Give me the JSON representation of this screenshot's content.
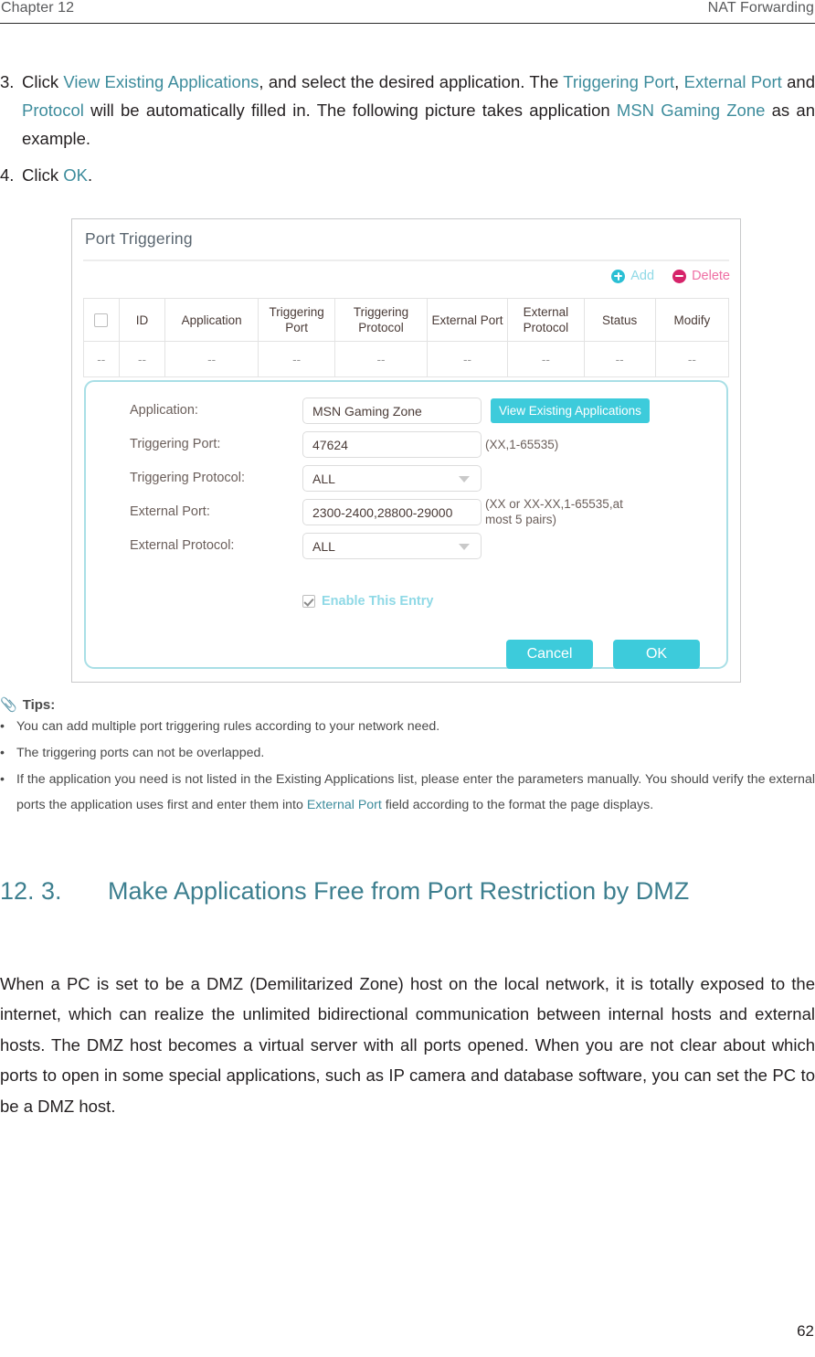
{
  "running_head": {
    "left": "Chapter 12",
    "right": "NAT Forwarding"
  },
  "steps": [
    {
      "number": "3.",
      "segments": [
        {
          "t": "Click ",
          "link": false
        },
        {
          "t": "View Existing Applications",
          "link": true
        },
        {
          "t": ", and select the desired application. The ",
          "link": false
        },
        {
          "t": "Triggering Port",
          "link": true
        },
        {
          "t": ", ",
          "link": false
        },
        {
          "t": "External Port",
          "link": true
        },
        {
          "t": " and ",
          "link": false
        },
        {
          "t": "Protocol",
          "link": true
        },
        {
          "t": " will be automatically filled in. The following picture takes application ",
          "link": false
        },
        {
          "t": "MSN Gaming Zone",
          "link": true
        },
        {
          "t": " as an example.",
          "link": false
        }
      ]
    },
    {
      "number": "4.",
      "segments": [
        {
          "t": "Click ",
          "link": false
        },
        {
          "t": "OK",
          "link": true
        },
        {
          "t": ".",
          "link": false
        }
      ]
    }
  ],
  "panel": {
    "title": "Port Triggering",
    "toolbar": {
      "add_label": "Add",
      "delete_label": "Delete",
      "add_icon": "plus-circle-icon",
      "delete_icon": "minus-circle-icon"
    },
    "table": {
      "headers": [
        "",
        "ID",
        "Application",
        "Triggering Port",
        "Triggering Protocol",
        "External Port",
        "External Protocol",
        "Status",
        "Modify"
      ],
      "rows": [
        [
          "--",
          "--",
          "--",
          "--",
          "--",
          "--",
          "--",
          "--",
          "--"
        ]
      ]
    },
    "form": {
      "fields": [
        {
          "label": "Application:",
          "type": "text",
          "value": "MSN Gaming Zone",
          "hint": "",
          "button": "View Existing Applications"
        },
        {
          "label": "Triggering Port:",
          "type": "text",
          "value": "47624",
          "hint": "(XX,1-65535)"
        },
        {
          "label": "Triggering Protocol:",
          "type": "select",
          "value": "ALL",
          "hint": ""
        },
        {
          "label": "External Port:",
          "type": "text",
          "value": "2300-2400,28800-29000",
          "hint": "(XX or XX-XX,1-65535,at most 5 pairs)"
        },
        {
          "label": "External Protocol:",
          "type": "select",
          "value": "ALL",
          "hint": ""
        }
      ],
      "enable_checkbox": {
        "label": "Enable This Entry",
        "checked": true
      },
      "cancel_label": "Cancel",
      "ok_label": "OK"
    }
  },
  "tips": {
    "icon": "paperclip-icon",
    "heading": "Tips:",
    "bullet": "•",
    "items": [
      [
        {
          "t": "You can add multiple port triggering rules according to your network need.",
          "link": false
        }
      ],
      [
        {
          "t": "The triggering ports can not be overlapped.",
          "link": false
        }
      ],
      [
        {
          "t": "If the application you need is not listed in the Existing Applications list, please enter the parameters manually. You should verify the external ports the application uses first and enter them into ",
          "link": false
        },
        {
          "t": "External Port",
          "link": true
        },
        {
          "t": " field according to the format the page displays.",
          "link": false
        }
      ]
    ]
  },
  "section": {
    "number": "12. 3.",
    "title": "Make Applications Free from Port Restriction by DMZ"
  },
  "body_paragraph": "When a PC is set to be a DMZ (Demilitarized Zone) host on the local network, it is totally exposed to the internet, which can realize the unlimited bidirectional communication between internal hosts and external hosts. The DMZ host becomes a virtual server with all ports opened. When you are not clear about which ports to open in some special applications, such as IP camera and database software, you can set the PC to be a DMZ host.",
  "page_number": "62",
  "colors": {
    "link": "#3d8c9c",
    "heading": "#3d7f8f",
    "accent_button": "#3dcbdb",
    "add_icon": "#2bbfd4",
    "delete_icon": "#d6236a",
    "panel_border": "#a9dfe6"
  }
}
